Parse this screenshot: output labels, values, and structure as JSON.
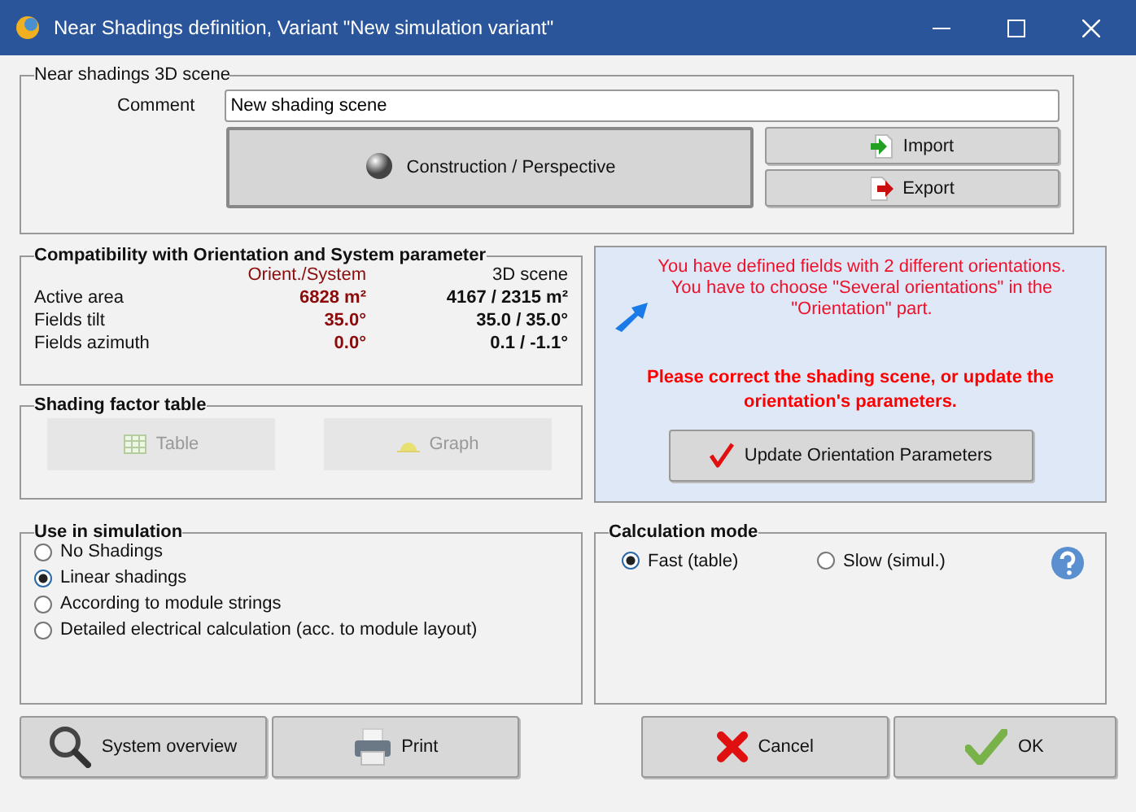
{
  "window": {
    "title": "Near Shadings definition, Variant \"New simulation variant\""
  },
  "scene": {
    "legend": "Near shadings 3D scene",
    "comment_label": "Comment",
    "comment_value": "New shading scene",
    "main_button": "Construction / Perspective",
    "side_buttons": [
      {
        "kind": "import",
        "label": "Import"
      },
      {
        "kind": "export",
        "label": "Export"
      }
    ]
  },
  "compatibility": {
    "legend": "Compatibility with Orientation and System parameter",
    "columns": [
      "Orient./System",
      "3D scene"
    ],
    "rows": [
      {
        "label": "Active area",
        "orient": "6828 m²",
        "scene": "4167 / 2315 m²"
      },
      {
        "label": "Fields tilt",
        "orient": "35.0°",
        "scene": "35.0 / 35.0°"
      },
      {
        "label": "Fields azimuth",
        "orient": "0.0°",
        "scene": "0.1 / -1.1°"
      }
    ]
  },
  "warning": {
    "message": "You have defined fields with 2 different orientations.\nYou have to choose \"Several orientations\" in the \"Orientation\" part.",
    "instruction": "Please correct the shading scene, or update the orientation's parameters.",
    "button": "Update Orientation Parameters"
  },
  "shading_table": {
    "legend": "Shading factor table",
    "buttons": [
      {
        "kind": "table",
        "label": "Table",
        "disabled": true
      },
      {
        "kind": "graph",
        "label": "Graph",
        "disabled": true
      }
    ]
  },
  "use_in_simulation": {
    "legend": "Use in simulation",
    "options": [
      {
        "label": "No Shadings",
        "selected": false
      },
      {
        "label": "Linear shadings",
        "selected": true
      },
      {
        "label": "According to module strings",
        "selected": false
      },
      {
        "label": "Detailed electrical calculation (acc. to module layout)",
        "selected": false
      }
    ]
  },
  "calculation_mode": {
    "legend": "Calculation mode",
    "options": [
      {
        "label": "Fast (table)",
        "selected": true
      },
      {
        "label": "Slow (simul.)",
        "selected": false
      }
    ]
  },
  "footer_buttons": [
    {
      "kind": "overview",
      "label": "System overview"
    },
    {
      "kind": "print",
      "label": "Print"
    },
    {
      "kind": "cancel",
      "label": "Cancel"
    },
    {
      "kind": "ok",
      "label": "OK"
    }
  ]
}
